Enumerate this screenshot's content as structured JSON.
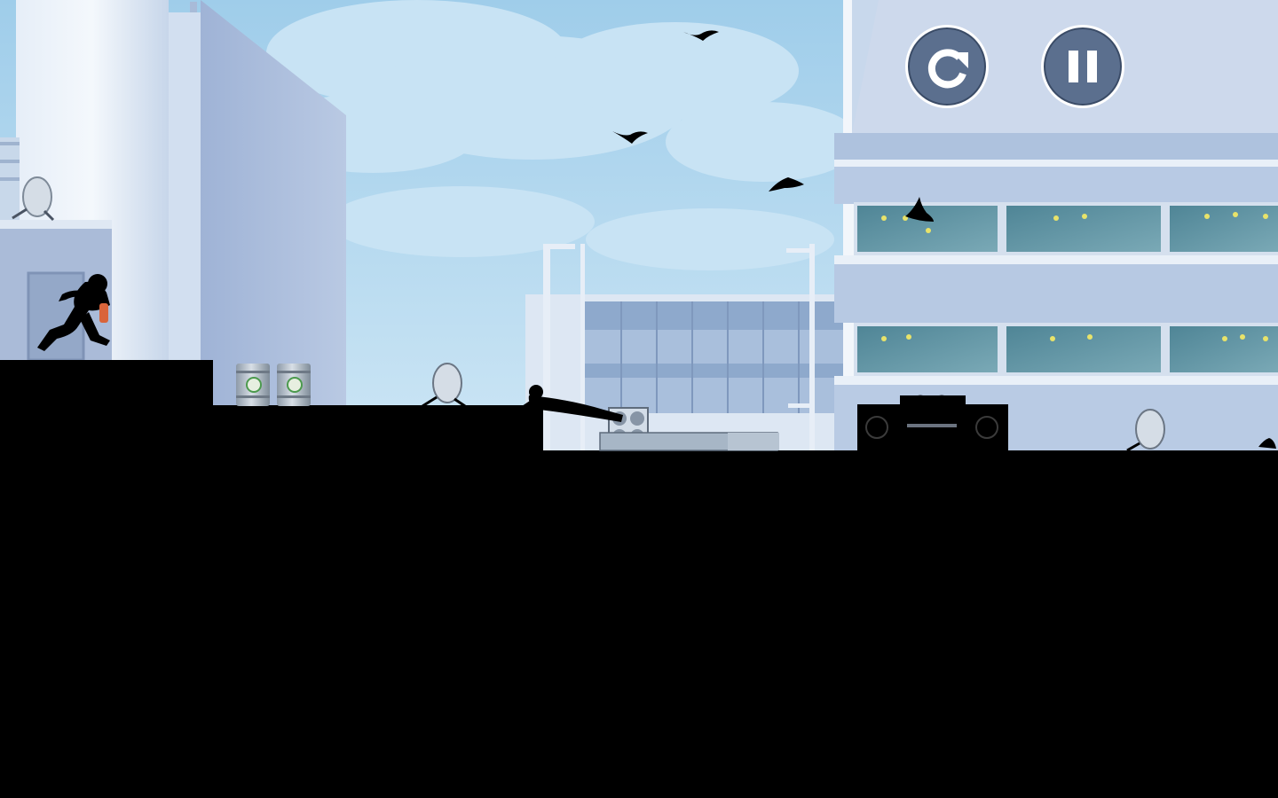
{
  "game": {
    "state": "running",
    "player": "runner-silhouette",
    "pursuer": "hunter-silhouette"
  },
  "hud": {
    "restart": {
      "icon": "restart-icon",
      "label": "Restart"
    },
    "pause": {
      "icon": "pause-icon",
      "label": "Pause"
    }
  },
  "colors": {
    "sky": "#a9d3ec",
    "cloud": "#c9e4f4",
    "building_light": "#e9f0f8",
    "building_mid": "#b7c9e2",
    "building_shadow": "#9cb0d2",
    "window_glass": "#5f8fa0",
    "silhouette": "#000000",
    "hud_fill": "#5b6f8e",
    "hud_border": "#ffffff",
    "runner_accent": "#d9643a"
  }
}
